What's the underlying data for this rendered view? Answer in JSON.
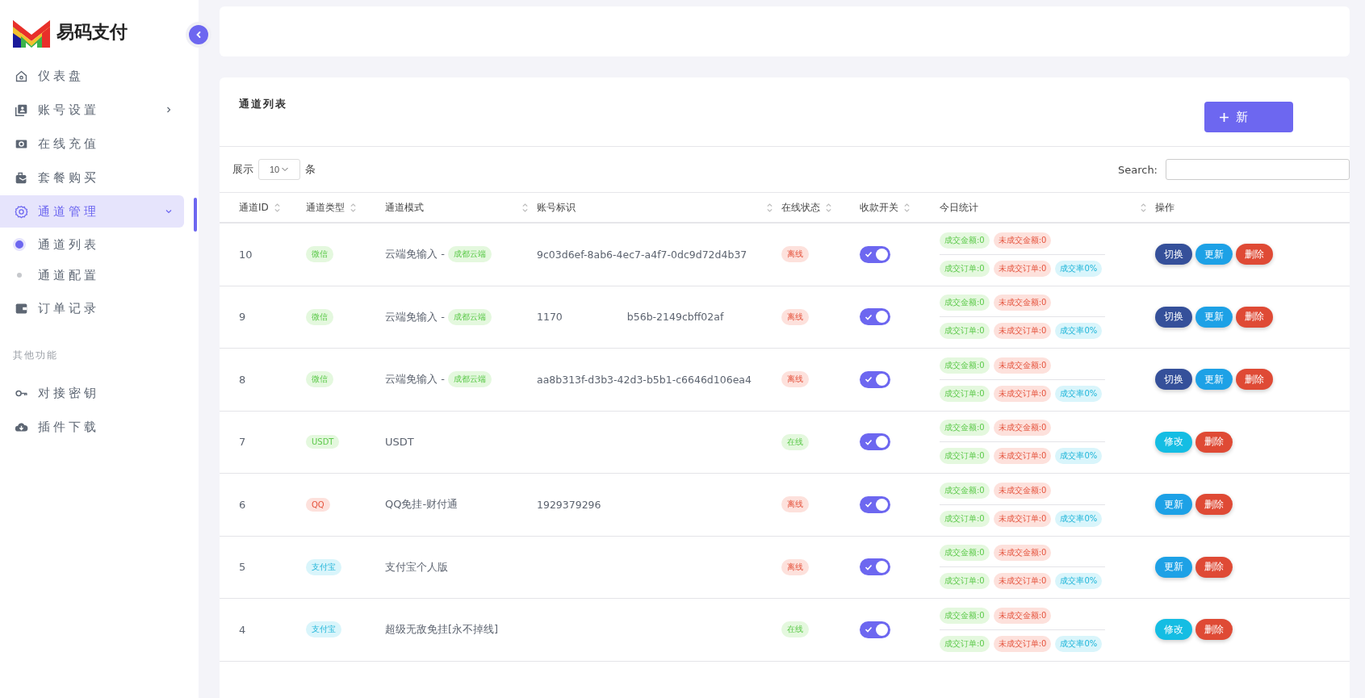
{
  "brand": {
    "name": "易码支付"
  },
  "sidebar": {
    "items": [
      {
        "label": "仪表盘",
        "selected": false
      },
      {
        "label": "账号设置",
        "selected": false,
        "expanded": false
      },
      {
        "label": "在线充值",
        "selected": false
      },
      {
        "label": "套餐购买",
        "selected": false
      },
      {
        "label": "通道管理",
        "selected": true,
        "expanded": true,
        "children": [
          {
            "label": "通道列表",
            "selected": true
          },
          {
            "label": "通道配置",
            "selected": false
          }
        ]
      },
      {
        "label": "订单记录",
        "selected": false
      }
    ],
    "section": "其他功能",
    "extra_items": [
      {
        "label": "对接密钥",
        "selected": false
      },
      {
        "label": "插件下载",
        "selected": false
      }
    ]
  },
  "card": {
    "title": "通道列表",
    "add_button": "新"
  },
  "length": {
    "prefix": "展示",
    "value": "10",
    "suffix": "条"
  },
  "search": {
    "label": "Search:"
  },
  "columns": [
    {
      "label": "通道ID",
      "sortable": true
    },
    {
      "label": "通道类型",
      "sortable": true
    },
    {
      "label": "通道模式",
      "sortable": true
    },
    {
      "label": "账号标识",
      "sortable": true
    },
    {
      "label": "在线状态",
      "sortable": true
    },
    {
      "label": "收款开关",
      "sortable": true
    },
    {
      "label": "今日统计",
      "sortable": true
    },
    {
      "label": "操作",
      "sortable": false
    }
  ],
  "rows": [
    {
      "id": "10",
      "type": {
        "text": "微信",
        "kind": "green"
      },
      "mode": "云端免输入 -",
      "mode_tag": "成都云端",
      "account": "9c03d6ef-8ab6-4ec7-a4f7-0dc9d72d4b37",
      "status": {
        "text": "离线",
        "online": false
      },
      "on": true,
      "stats": [
        [
          {
            "text": "成交金额:0",
            "kind": "ok"
          },
          {
            "text": "未成交金额:0",
            "kind": "fail"
          }
        ],
        [
          {
            "text": "成交订单:0",
            "kind": "ok"
          },
          {
            "text": "未成交订单:0",
            "kind": "fail"
          },
          {
            "text": "成交率0%",
            "kind": "rate"
          }
        ]
      ],
      "actions": [
        {
          "text": "切换",
          "kind": "switch"
        },
        {
          "text": "更新",
          "kind": "update"
        },
        {
          "text": "删除",
          "kind": "delete"
        }
      ]
    },
    {
      "id": "9",
      "type": {
        "text": "微信",
        "kind": "green"
      },
      "mode": "云端免输入 -",
      "mode_tag": "成都云端",
      "account": "1170",
      "account_tail": "b56b-2149cbff02af",
      "status": {
        "text": "离线",
        "online": false
      },
      "on": true,
      "stats": [
        [
          {
            "text": "成交金额:0",
            "kind": "ok"
          },
          {
            "text": "未成交金额:0",
            "kind": "fail"
          }
        ],
        [
          {
            "text": "成交订单:0",
            "kind": "ok"
          },
          {
            "text": "未成交订单:0",
            "kind": "fail"
          },
          {
            "text": "成交率0%",
            "kind": "rate"
          }
        ]
      ],
      "actions": [
        {
          "text": "切换",
          "kind": "switch"
        },
        {
          "text": "更新",
          "kind": "update"
        },
        {
          "text": "删除",
          "kind": "delete"
        }
      ]
    },
    {
      "id": "8",
      "type": {
        "text": "微信",
        "kind": "green"
      },
      "mode": "云端免输入 -",
      "mode_tag": "成都云端",
      "account": "aa8b313f-d3b3-42d3-b5b1-c6646d106ea4",
      "status": {
        "text": "离线",
        "online": false
      },
      "on": true,
      "stats": [
        [
          {
            "text": "成交金额:0",
            "kind": "ok"
          },
          {
            "text": "未成交金额:0",
            "kind": "fail"
          }
        ],
        [
          {
            "text": "成交订单:0",
            "kind": "ok"
          },
          {
            "text": "未成交订单:0",
            "kind": "fail"
          },
          {
            "text": "成交率0%",
            "kind": "rate"
          }
        ]
      ],
      "actions": [
        {
          "text": "切换",
          "kind": "switch"
        },
        {
          "text": "更新",
          "kind": "update"
        },
        {
          "text": "删除",
          "kind": "delete"
        }
      ]
    },
    {
      "id": "7",
      "type": {
        "text": "USDT",
        "kind": "green"
      },
      "mode": "USDT",
      "status": {
        "text": "在线",
        "online": true
      },
      "on": true,
      "stats": [
        [
          {
            "text": "成交金额:0",
            "kind": "ok"
          },
          {
            "text": "未成交金额:0",
            "kind": "fail"
          }
        ],
        [
          {
            "text": "成交订单:0",
            "kind": "ok"
          },
          {
            "text": "未成交订单:0",
            "kind": "fail"
          },
          {
            "text": "成交率0%",
            "kind": "rate"
          }
        ]
      ],
      "actions": [
        {
          "text": "修改",
          "kind": "edit"
        },
        {
          "text": "删除",
          "kind": "delete"
        }
      ]
    },
    {
      "id": "6",
      "type": {
        "text": "QQ",
        "kind": "red"
      },
      "mode": "QQ免挂-财付通",
      "account": "1929379296",
      "status": {
        "text": "离线",
        "online": false
      },
      "on": true,
      "stats": [
        [
          {
            "text": "成交金额:0",
            "kind": "ok"
          },
          {
            "text": "未成交金额:0",
            "kind": "fail"
          }
        ],
        [
          {
            "text": "成交订单:0",
            "kind": "ok"
          },
          {
            "text": "未成交订单:0",
            "kind": "fail"
          },
          {
            "text": "成交率0%",
            "kind": "rate"
          }
        ]
      ],
      "actions": [
        {
          "text": "更新",
          "kind": "update"
        },
        {
          "text": "删除",
          "kind": "delete"
        }
      ]
    },
    {
      "id": "5",
      "type": {
        "text": "支付宝",
        "kind": "cyan"
      },
      "mode": "支付宝个人版",
      "status": {
        "text": "离线",
        "online": false
      },
      "on": true,
      "stats": [
        [
          {
            "text": "成交金额:0",
            "kind": "ok"
          },
          {
            "text": "未成交金额:0",
            "kind": "fail"
          }
        ],
        [
          {
            "text": "成交订单:0",
            "kind": "ok"
          },
          {
            "text": "未成交订单:0",
            "kind": "fail"
          },
          {
            "text": "成交率0%",
            "kind": "rate"
          }
        ]
      ],
      "actions": [
        {
          "text": "更新",
          "kind": "update"
        },
        {
          "text": "删除",
          "kind": "delete"
        }
      ]
    },
    {
      "id": "4",
      "type": {
        "text": "支付宝",
        "kind": "cyan"
      },
      "mode": "超级无敌免挂[永不掉线]",
      "status": {
        "text": "在线",
        "online": true
      },
      "on": true,
      "stats": [
        [
          {
            "text": "成交金额:0",
            "kind": "ok"
          },
          {
            "text": "未成交金额:0",
            "kind": "fail"
          }
        ],
        [
          {
            "text": "成交订单:0",
            "kind": "ok"
          },
          {
            "text": "未成交订单:0",
            "kind": "fail"
          },
          {
            "text": "成交率0%",
            "kind": "rate"
          }
        ]
      ],
      "actions": [
        {
          "text": "修改",
          "kind": "edit"
        },
        {
          "text": "删除",
          "kind": "delete"
        }
      ]
    }
  ]
}
